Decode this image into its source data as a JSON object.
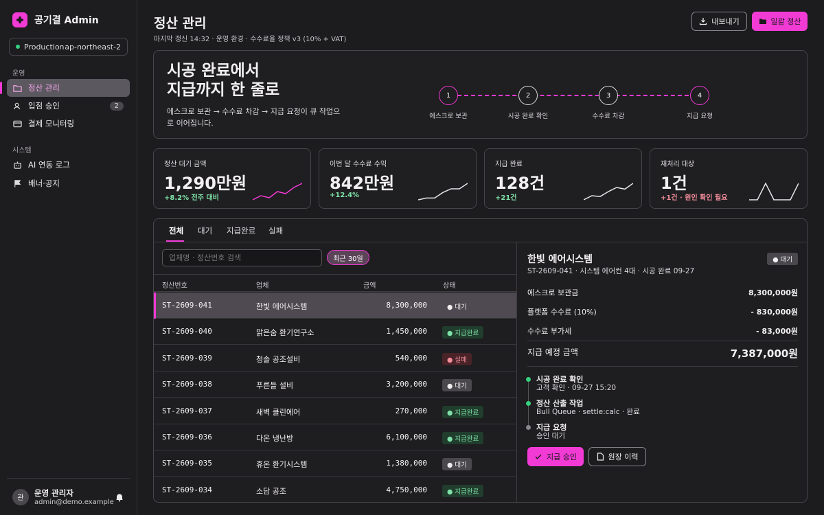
{
  "brand": {
    "title": "공기결 Admin"
  },
  "env": {
    "name": "Production",
    "region": "ap-northeast-2"
  },
  "sidebar": {
    "section1": "운영",
    "section2": "시스템",
    "items": [
      {
        "label": "정산 관리"
      },
      {
        "label": "입점 승인",
        "badge": "2"
      },
      {
        "label": "결제 모니터링"
      },
      {
        "label": "AI 연동 로그"
      },
      {
        "label": "배너·공지"
      }
    ]
  },
  "user": {
    "name": "운영 관리자",
    "email": "admin@demo.example",
    "avatar": "관"
  },
  "header": {
    "title": "정산 관리",
    "subtitle": "마지막 갱신 14:32 · 운영 환경 · 수수료율 정책 v3 (10% + VAT)",
    "export_label": "내보내기",
    "bulk_label": "일괄 정산"
  },
  "hero": {
    "title_line1": "시공 완료에서",
    "title_line2": "지급까지 한 줄로",
    "desc": "에스크로 보관 → 수수료 차감 → 지급 요청이 큐 작업으로 이어집니다.",
    "steps": [
      {
        "n": "1",
        "label": "에스크로 보관"
      },
      {
        "n": "2",
        "label": "시공 완료 확인"
      },
      {
        "n": "3",
        "label": "수수료 차감"
      },
      {
        "n": "4",
        "label": "지급 요청"
      }
    ]
  },
  "kpis": [
    {
      "label": "정산 대기 금액",
      "value": "1,290만원",
      "delta": "+8.2% 전주 대비",
      "color": "#f23ad5",
      "spark": [
        2,
        3,
        2.5,
        4,
        3.5,
        5,
        6
      ]
    },
    {
      "label": "이번 달 수수료 수익",
      "value": "842만원",
      "delta": "+12.4%",
      "color": "#e8e6ea",
      "spark": [
        1,
        1.5,
        1.5,
        3,
        4,
        4,
        5.5
      ]
    },
    {
      "label": "지급 완료",
      "value": "128건",
      "delta": "+21건",
      "color": "#e8e6ea",
      "spark": [
        1,
        2,
        1.8,
        3,
        4,
        3.6,
        5
      ]
    },
    {
      "label": "재처리 대상",
      "value": "1건",
      "delta": "+1건 · 원인 확인 필요",
      "color": "#e8e6ea",
      "spark": [
        1,
        1,
        5,
        1,
        1,
        1,
        5
      ]
    }
  ],
  "tabs": [
    {
      "label": "전체"
    },
    {
      "label": "대기"
    },
    {
      "label": "지급완료"
    },
    {
      "label": "실패"
    }
  ],
  "search": {
    "placeholder": "업체명 · 정산번호 검색"
  },
  "filter": {
    "label": "최근 30일"
  },
  "table": {
    "headers": [
      "정산번호",
      "업체",
      "금액",
      "상태"
    ],
    "rows": [
      {
        "id": "ST-2609-041",
        "vendor": "한빛 에어시스템",
        "amount": "8,300,000",
        "status": "대기",
        "type": "wait"
      },
      {
        "id": "ST-2609-040",
        "vendor": "맑은숨 환기연구소",
        "amount": "1,450,000",
        "status": "지급완료",
        "type": "done"
      },
      {
        "id": "ST-2609-039",
        "vendor": "청솔 공조설비",
        "amount": "540,000",
        "status": "실패",
        "type": "fail"
      },
      {
        "id": "ST-2609-038",
        "vendor": "푸른들 설비",
        "amount": "3,200,000",
        "status": "대기",
        "type": "wait"
      },
      {
        "id": "ST-2609-037",
        "vendor": "새벽 클린에어",
        "amount": "270,000",
        "status": "지급완료",
        "type": "done"
      },
      {
        "id": "ST-2609-036",
        "vendor": "다온 냉난방",
        "amount": "6,100,000",
        "status": "지급완료",
        "type": "done"
      },
      {
        "id": "ST-2609-035",
        "vendor": "휴온 환기시스템",
        "amount": "1,380,000",
        "status": "대기",
        "type": "wait"
      },
      {
        "id": "ST-2609-034",
        "vendor": "소담 공조",
        "amount": "4,750,000",
        "status": "지급완료",
        "type": "done"
      }
    ]
  },
  "detail": {
    "title": "한빛 에어시스템",
    "badge": "대기",
    "subtitle": "ST-2609-041 · 시스템 에어컨 4대 · 시공 완료 09-27",
    "rows": [
      {
        "k": "에스크로 보관금",
        "v": "8,300,000원"
      },
      {
        "k": "플랫폼 수수료 (10%)",
        "v": "- 830,000원"
      },
      {
        "k": "수수료 부가세",
        "v": "- 83,000원"
      }
    ],
    "total_label": "지급 예정 금액",
    "total_value": "7,387,000원",
    "timeline": [
      {
        "t": "시공 완료 확인",
        "s": "고객 확인 · 09-27 15:20",
        "color": "#35d07f"
      },
      {
        "t": "정산 산출 작업",
        "s": "Bull Queue · settle:calc · 완료",
        "color": "#35d07f"
      },
      {
        "t": "지급 요청",
        "s": "승인 대기",
        "color": "#8a868e"
      }
    ],
    "approve_label": "지급 승인",
    "ledger_label": "원장 이력"
  }
}
